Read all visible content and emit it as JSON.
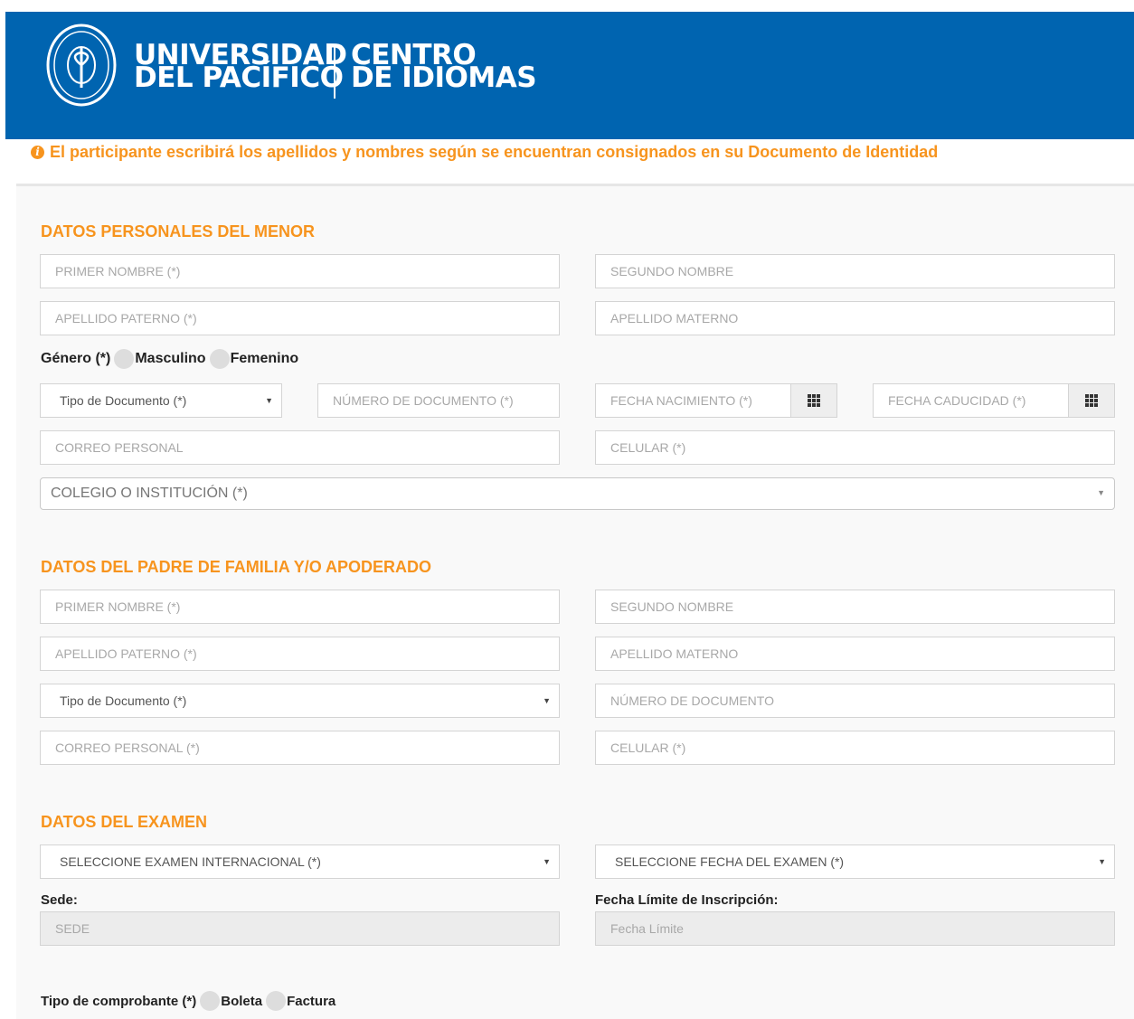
{
  "header": {
    "university_line1": "UNIVERSIDAD",
    "university_line2": "DEL PACÍFICO",
    "center_line1": "CENTRO",
    "center_line2": "DE IDIOMAS",
    "brand_color": "#0064b0",
    "seal_text_top": "UNIVERSIDAD DEL PACIFICO",
    "seal_text_bottom": "LIMA - PERU"
  },
  "notice": {
    "icon": "info-icon",
    "text": "El participante escribirá los apellidos y nombres según se encuentran consignados en su Documento de Identidad",
    "color": "#f7941e"
  },
  "minor": {
    "title": "DATOS PERSONALES DEL MENOR",
    "first_name": "PRIMER NOMBRE (*)",
    "second_name": "SEGUNDO NOMBRE",
    "paternal_surname": "APELLIDO PATERNO (*)",
    "maternal_surname": "APELLIDO MATERNO",
    "gender_label": "Género (*)",
    "gender_male": "Masculino",
    "gender_female": "Femenino",
    "doc_type": "Tipo de Documento (*)",
    "doc_number": "NÚMERO DE DOCUMENTO (*)",
    "birth_date": "FECHA NACIMIENTO (*)",
    "expiry_date": "FECHA CADUCIDAD (*)",
    "email": "CORREO PERSONAL",
    "mobile": "CELULAR (*)",
    "school": "COLEGIO O INSTITUCIÓN (*)"
  },
  "guardian": {
    "title": "DATOS DEL PADRE DE FAMILIA Y/O APODERADO",
    "first_name": "PRIMER NOMBRE (*)",
    "second_name": "SEGUNDO NOMBRE",
    "paternal_surname": "APELLIDO PATERNO (*)",
    "maternal_surname": "APELLIDO MATERNO",
    "doc_type": "Tipo de Documento (*)",
    "doc_number": "NÚMERO DE DOCUMENTO",
    "email": "CORREO PERSONAL (*)",
    "mobile": "CELULAR (*)"
  },
  "exam": {
    "title": "DATOS DEL EXAMEN",
    "exam_select": "SELECCIONE EXAMEN INTERNACIONAL (*)",
    "date_select": "SELECCIONE FECHA DEL EXAMEN (*)",
    "site_label": "Sede:",
    "site_value": "SEDE",
    "deadline_label": "Fecha Límite de Inscripción:",
    "deadline_value": "Fecha Límite"
  },
  "receipt": {
    "label": "Tipo de comprobante (*)",
    "boleta": "Boleta",
    "factura": "Factura"
  }
}
